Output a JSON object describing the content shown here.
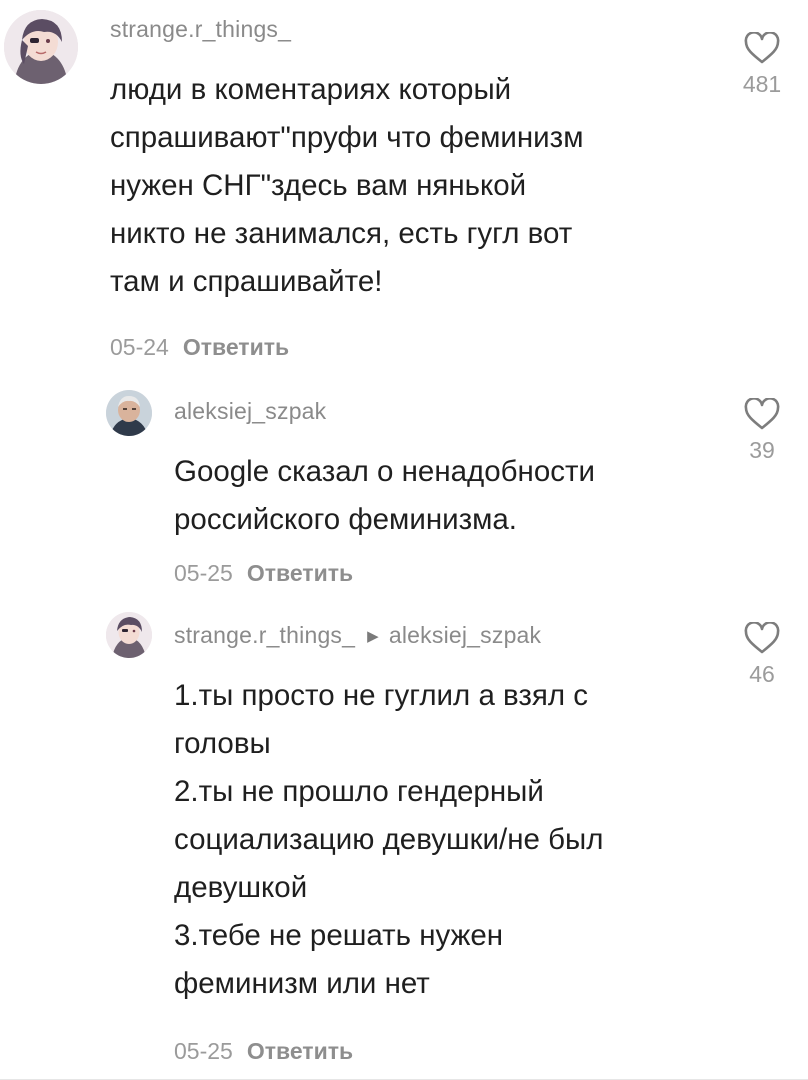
{
  "comments": [
    {
      "username": "strange.r_things_",
      "text": "люди в коментариях который\nспрашивают\"пруфи что феминизм\nнужен СНГ\"здесь вам нянькой\nникто не занимался, есть гугл вот\nтам и спрашивайте!",
      "date": "05-24",
      "reply_label": "Ответить",
      "likes": "481"
    },
    {
      "username": "aleksiej_szpak",
      "text": "Google сказал о ненадобности\nроссийского феминизма.",
      "date": "05-25",
      "reply_label": "Ответить",
      "likes": "39"
    },
    {
      "username": "strange.r_things_",
      "reply_to": "aleksiej_szpak",
      "text": "1.ты просто не гуглил а взял с\nголовы\n2.ты не прошло гендерный\nсоциализацию девушки/не был\nдевушкой\n3.тебе не решать нужен\nфеминизм или нет",
      "date": "05-25",
      "reply_label": "Ответить",
      "likes": "46"
    }
  ],
  "icons": {
    "like": "heart-outline-icon",
    "reply_arrow": "triangle-right-icon"
  },
  "colors": {
    "text": "#1f1f1f",
    "muted": "#9b9b9b",
    "heart_stroke": "#7d7d7d"
  }
}
